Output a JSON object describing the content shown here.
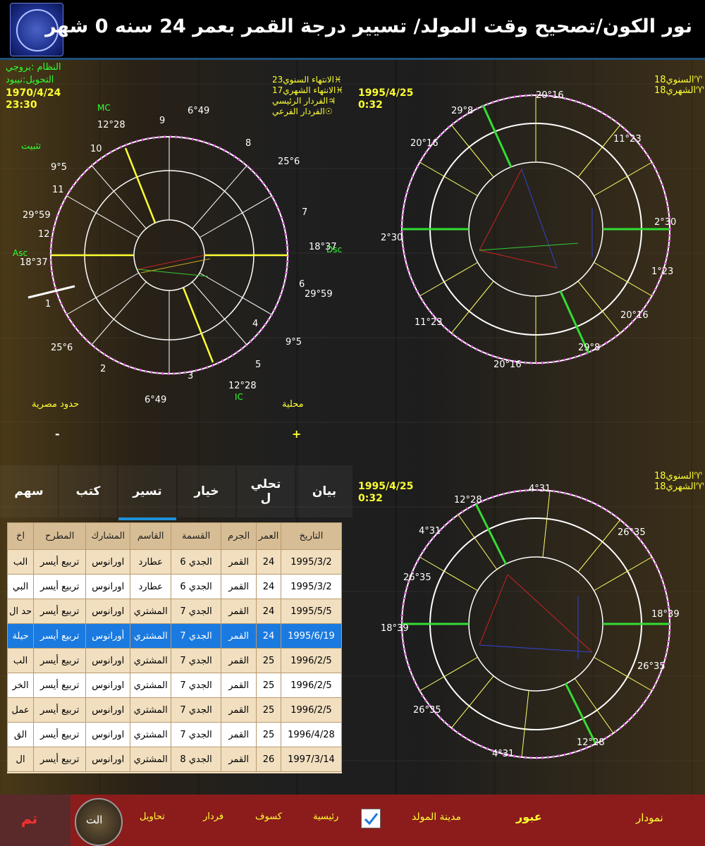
{
  "header": {
    "title": "نور الكون/تصحيح وقت المولد/  تسيير درجة القمر بعمر 24 سنه 0 شهر"
  },
  "natal": {
    "system": "النظام :بروجي",
    "conversion": "التحويل:نيبود",
    "date": "1970/4/24",
    "time": "23:30",
    "fix": "تثبيت",
    "house_cusp_degrees": [
      "6°49",
      "12°28",
      "9°5",
      "29°59",
      "18°37",
      "25°6",
      "25°6",
      "18°37",
      "29°59",
      "9°5",
      "12°28",
      "6°49"
    ],
    "house_numbers": [
      "1",
      "2",
      "3",
      "4",
      "5",
      "6",
      "7",
      "8",
      "9",
      "10",
      "11",
      "12"
    ],
    "angles": {
      "mc": "MC",
      "ic": "IC",
      "asc": "Asc",
      "dsc": "Dsc"
    },
    "left_label": "حدود مصرية",
    "right_label": "محلية",
    "minus": "-",
    "plus": "+"
  },
  "progressed": {
    "info1": "الانتهاء السنوي23♓",
    "info2": "17الانتهاء الشهري♓",
    "info3": "الفردار الرئيسي♃",
    "info4": "الفردار الفرعي☉",
    "date": "1995/4/25",
    "time": "0:32",
    "annual": "السنوي18♈",
    "monthly": "الشهري18♈",
    "degrees": [
      "29°8",
      "20°16",
      "2°30",
      "11°23",
      "11°23",
      "1°23",
      "20°16",
      "29°8",
      "20°16",
      "20°16",
      "2°30"
    ]
  },
  "transit": {
    "date": "1995/4/25",
    "time": "0:32",
    "annual": "السنوي18♈",
    "monthly": "الشهري18♈",
    "degrees": [
      "12°28",
      "4°31",
      "26°35",
      "18°39",
      "26°35",
      "4°31",
      "12°28",
      "26°35",
      "18°39",
      "26°35",
      "4°31"
    ]
  },
  "tabs": [
    {
      "label": "بيان",
      "active": false
    },
    {
      "label": "تحلي\nل",
      "active": false
    },
    {
      "label": "خيار",
      "active": false
    },
    {
      "label": "تسير",
      "active": true
    },
    {
      "label": "كتب",
      "active": false
    },
    {
      "label": "سهم",
      "active": false
    }
  ],
  "table": {
    "headers": [
      "التاريخ",
      "العمر",
      "الجرم",
      "القسمة",
      "القاسم",
      "المشارك",
      "المطرح",
      "اخ"
    ],
    "rows": [
      [
        "1995/3/2",
        "24",
        "القمر",
        "الجدي 6",
        "عطارد",
        "اورانوس",
        "تربيع أيسر",
        "الب"
      ],
      [
        "1995/3/2",
        "24",
        "القمر",
        "الجدي 6",
        "عطارد",
        "اورانوس",
        "تربيع أيسر",
        "البي"
      ],
      [
        "1995/5/5",
        "24",
        "القمر",
        "الجدي 7",
        "المشتري",
        "اورانوس",
        "تربيع أيسر",
        "حد ال"
      ],
      [
        "1995/6/19",
        "24",
        "القمر",
        "الجدي 7",
        "المشتري",
        "أورانوس",
        "تربيع أيسر",
        "حيلة"
      ],
      [
        "1996/2/5",
        "25",
        "القمر",
        "الجدي 7",
        "المشتري",
        "اورانوس",
        "تربيع أيسر",
        "الب"
      ],
      [
        "1996/2/5",
        "25",
        "القمر",
        "الجدي 7",
        "المشتري",
        "اورانوس",
        "تربيع أيسر",
        "الخر"
      ],
      [
        "1996/2/5",
        "25",
        "القمر",
        "الجدي 7",
        "المشتري",
        "اورانوس",
        "تربيع أيسر",
        "عمل"
      ],
      [
        "1996/4/28",
        "25",
        "القمر",
        "الجدي 7",
        "المشتري",
        "اورانوس",
        "تربيع أيسر",
        "الق"
      ],
      [
        "1997/3/14",
        "26",
        "القمر",
        "الجدي 8",
        "المشتري",
        "اورانوس",
        "تربيع أيسر",
        "ال"
      ]
    ],
    "selected_row": 3
  },
  "bottom_bar": {
    "done": "تم",
    "logo_text": "الت",
    "transformations": "تحاويل",
    "firdar": "فردار",
    "eclipses": "كسوف",
    "main": "رئيسية",
    "birth_city": "مدينة المولد",
    "transits": "عبور",
    "namudar": "نمودار",
    "checkbox_checked": true
  },
  "colors": {
    "yellow": "#ffff33",
    "green": "#33ff33",
    "selected": "#1a7ae0",
    "bottom": "#8c1c1c"
  }
}
